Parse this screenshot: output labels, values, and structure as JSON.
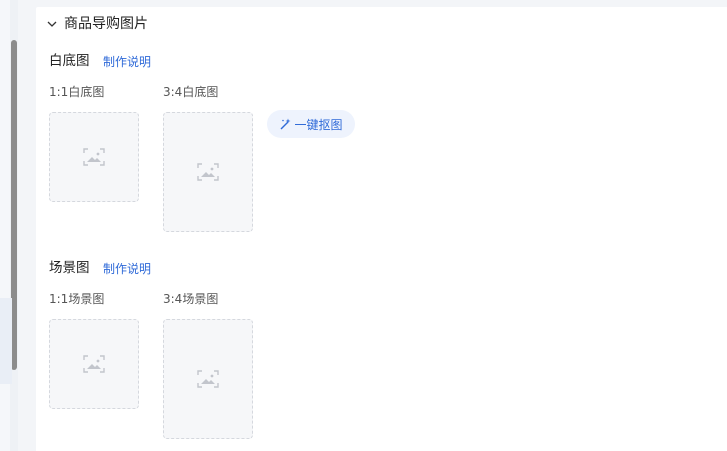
{
  "section": {
    "title": "商品导购图片",
    "expanded_icon": "chevron-down-icon"
  },
  "white_bg": {
    "title": "白底图",
    "help_link": "制作说明",
    "slots": [
      {
        "label": "1:1白底图"
      },
      {
        "label": "3:4白底图"
      }
    ],
    "action": {
      "label": "一键抠图",
      "icon": "magic-wand-icon"
    }
  },
  "scene": {
    "title": "场景图",
    "help_link": "制作说明",
    "slots": [
      {
        "label": "1:1场景图"
      },
      {
        "label": "3:4场景图"
      }
    ]
  },
  "colors": {
    "accent": "#2f6ad8",
    "placeholder_bg": "#f6f7f9",
    "placeholder_border": "#d5d8de"
  },
  "icons": {
    "placeholder": "image-placeholder-icon"
  }
}
